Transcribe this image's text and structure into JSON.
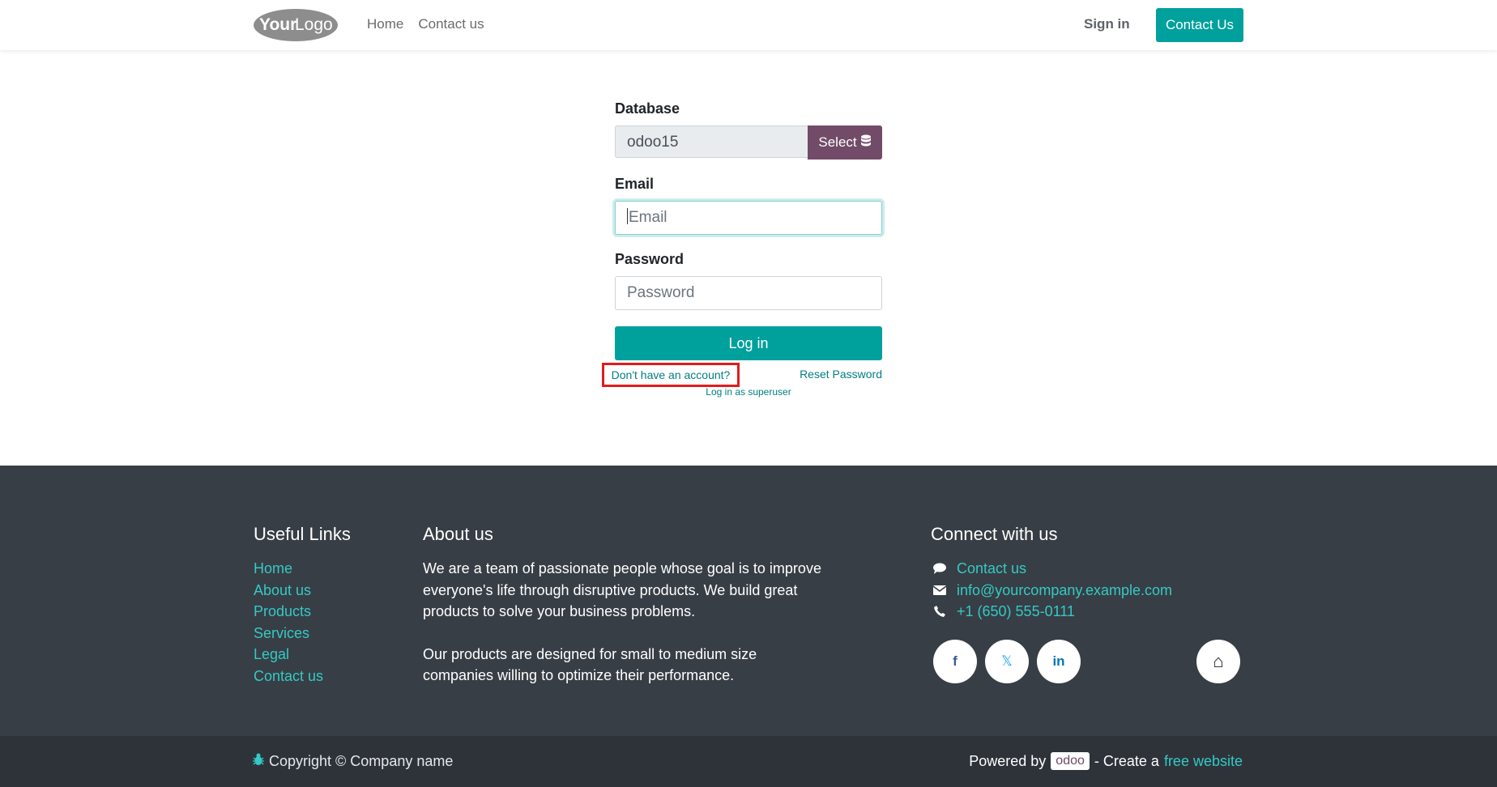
{
  "header": {
    "logo_text_bold": "Your",
    "logo_text": "Logo",
    "nav": [
      "Home",
      "Contact us"
    ],
    "signin": "Sign in",
    "contact_button": "Contact Us"
  },
  "form": {
    "database_label": "Database",
    "database_value": "odoo15",
    "select_label": "Select",
    "email_label": "Email",
    "email_placeholder": "Email",
    "password_label": "Password",
    "password_placeholder": "Password",
    "login_button": "Log in",
    "signup_link": "Don't have an account?",
    "reset_link": "Reset Password",
    "superuser_link": "Log in as superuser"
  },
  "footer": {
    "useful_title": "Useful Links",
    "useful_links": [
      "Home",
      "About us",
      "Products",
      "Services",
      "Legal",
      "Contact us"
    ],
    "about_title": "About us",
    "about_p1": "We are a team of passionate people whose goal is to improve everyone's life through disruptive products. We build great products to solve your business problems.",
    "about_p2": "Our products are designed for small to medium size companies willing to optimize their performance.",
    "connect_title": "Connect with us",
    "connect": {
      "contact": "Contact us",
      "email": "info@yourcompany.example.com",
      "phone": "+1 (650) 555-0111"
    },
    "social": {
      "facebook": "f",
      "x": "𝕏",
      "linkedin": "in",
      "home": "⌂"
    }
  },
  "copybar": {
    "copyright": "Copyright © Company name",
    "powered_by": "Powered by",
    "odoo": "odoo",
    "create": "- Create a",
    "free_website": "free website"
  },
  "colors": {
    "primary": "#00a09d",
    "secondary": "#714b67",
    "link": "#017e84",
    "footer_bg": "#383e45",
    "highlight": "#e21c1c"
  }
}
